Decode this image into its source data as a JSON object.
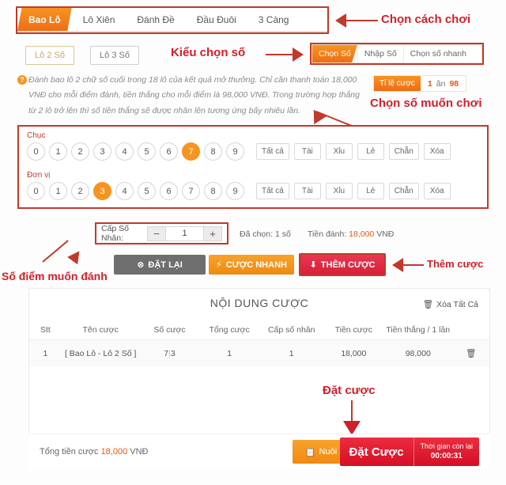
{
  "colors": {
    "accent_orange": "#f79421",
    "accent_red": "#d81e38",
    "annotation_red": "#d01f2b",
    "gold": "#f0b429"
  },
  "tabs": [
    {
      "label": "Bao Lô",
      "active": true
    },
    {
      "label": "Lô Xiên",
      "active": false
    },
    {
      "label": "Đánh Đề",
      "active": false
    },
    {
      "label": "Đầu Đuôi",
      "active": false
    },
    {
      "label": "3 Càng",
      "active": false
    }
  ],
  "subtypes": [
    {
      "label": "Lô 2 Số",
      "active": true
    },
    {
      "label": "Lô 3 Số",
      "active": false
    }
  ],
  "modes": [
    {
      "label": "Chọn Số",
      "active": true
    },
    {
      "label": "Nhập Số",
      "active": false
    },
    {
      "label": "Chọn số nhanh",
      "active": false
    }
  ],
  "description": "Đánh bao lô 2 chữ số cuối trong 18 lô của kết quả mở thưởng. Chỉ cần thanh toán 18,000 VNĐ cho mỗi điểm đánh, tiền thắng cho mỗi điểm là 98,000 VNĐ. Trong trường hợp thắng từ 2 lô trở lên thì số tiền thắng sẽ được nhân lên tương ứng bấy nhiêu lần.",
  "ratio": {
    "label": "Tỉ lệ cược",
    "left": "1",
    "mid": "ăn",
    "right": "98"
  },
  "picker": {
    "rows": [
      {
        "label": "Chục",
        "digits": [
          "0",
          "1",
          "2",
          "3",
          "4",
          "5",
          "6",
          "7",
          "8",
          "9"
        ],
        "selected": "7",
        "quick": [
          "Tất cả",
          "Tài",
          "Xỉu",
          "Lẻ",
          "Chẵn",
          "Xóa"
        ]
      },
      {
        "label": "Đơn vị",
        "digits": [
          "0",
          "1",
          "2",
          "3",
          "4",
          "5",
          "6",
          "7",
          "8",
          "9"
        ],
        "selected": "3",
        "quick": [
          "Tất cả",
          "Tài",
          "Xỉu",
          "Lẻ",
          "Chẵn",
          "Xóa"
        ]
      }
    ]
  },
  "multiplier": {
    "label": "Cấp Số Nhân:",
    "value": "1",
    "minus": "−",
    "plus": "+"
  },
  "status": {
    "selected_label": "Đã chọn:",
    "selected_value": "1 số",
    "amount_label": "Tiền đánh:",
    "amount_value": "18,000",
    "currency": "VNĐ"
  },
  "actions": {
    "reset": "ĐẶT LẠI",
    "reset_icon": "⊗",
    "fast": "CƯỢC NHANH",
    "fast_icon": "⚡",
    "add": "THÊM CƯỢC",
    "add_icon": "⬇"
  },
  "bet_card": {
    "title": "NỘI DUNG CƯỢC",
    "clear_all": "Xóa Tất Cả",
    "clear_all_icon": "🗑",
    "headers": [
      "Stt",
      "Tên cược",
      "Số cược",
      "Tổng cược",
      "Cấp số nhân",
      "Tiền cược",
      "Tiền thắng / 1 lần",
      ""
    ],
    "rows": [
      {
        "stt": "1",
        "name": "[ Bao Lô - Lô 2 Số ]",
        "numbers_left": "7",
        "numbers_sep": "|",
        "numbers_right": "3",
        "total": "1",
        "multiplier": "1",
        "amount": "18,000",
        "win": "98,000",
        "delete_icon": "🗑"
      }
    ]
  },
  "footer": {
    "total_label": "Tổng tiền cược",
    "total_value": "18,000",
    "currency": "VNĐ",
    "nuoi": "Nuôi",
    "nuoi_icon": "📋",
    "place_bet": "Đặt Cược",
    "time_label": "Thời gian còn lại",
    "time_value": "00:00:31"
  },
  "annotations": {
    "play_mode": "Chọn cách chơi",
    "number_mode": "Kiểu chọn số",
    "pick_numbers": "Chọn số muốn chơi",
    "points": "Số điểm muốn đánh",
    "add_bet": "Thêm cược",
    "place_bet": "Đặt cược"
  }
}
